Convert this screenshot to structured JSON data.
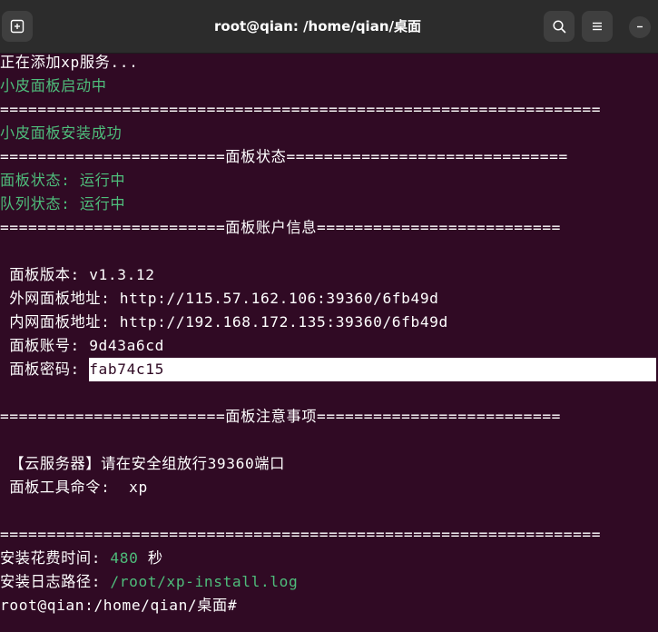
{
  "window": {
    "title": "root@qian: /home/qian/桌面"
  },
  "toolbar": {
    "new_tab_icon": "new-tab-icon",
    "search_icon": "search-icon",
    "menu_icon": "hamburger-menu-icon",
    "minimize_icon": "minimize-icon"
  },
  "colors": {
    "background": "#300a24",
    "titlebar": "#2c2c2c",
    "green": "#4ebd7b",
    "text": "#ffffff"
  },
  "terminal": {
    "adding_service": "正在添加xp服务...",
    "panel_starting": "小皮面板启动中",
    "sep_full_1": "================================================================",
    "install_success": "小皮面板安装成功",
    "sep_status": "========================面板状态==============================",
    "panel_status": "面板状态: 运行中",
    "queue_status": "队列状态: 运行中",
    "sep_account": "========================面板账户信息==========================",
    "version_label": " 面板版本: ",
    "version_value": "v1.3.12",
    "external_label": " 外网面板地址: ",
    "external_value": "http://115.57.162.106:39360/6fb49d",
    "internal_label": " 内网面板地址: ",
    "internal_value": "http://192.168.172.135:39360/6fb49d",
    "account_label": " 面板账号: ",
    "account_value": "9d43a6cd",
    "password_label": " 面板密码: ",
    "password_value": "fab74c15",
    "sep_notes": "========================面板注意事项==========================",
    "cloud_note": " 【云服务器】请在安全组放行39360端口",
    "tool_cmd_label": " 面板工具命令:  ",
    "tool_cmd_value": "xp",
    "sep_full_2": "================================================================",
    "install_time_label": "安装花费时间: ",
    "install_time_value": "480",
    "install_time_unit": " 秒",
    "log_path_label": "安装日志路径: ",
    "log_path_value": "/root/xp-install.log",
    "prompt": "root@qian:/home/qian/桌面# "
  }
}
